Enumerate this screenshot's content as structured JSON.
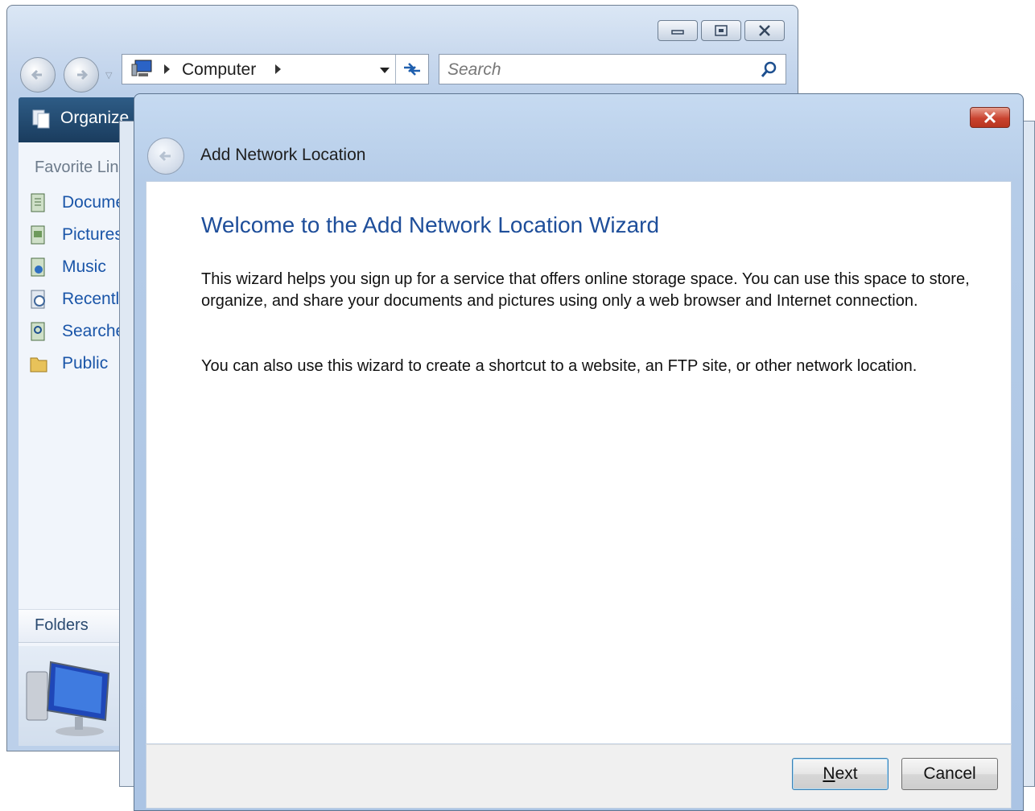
{
  "explorer": {
    "address": {
      "crumb": "Computer"
    },
    "search": {
      "placeholder": "Search"
    },
    "command_bar": {
      "organize_label": "Organize"
    },
    "favorite_links": {
      "title": "Favorite Links",
      "items": [
        {
          "label": "Documents",
          "icon": "documents-icon"
        },
        {
          "label": "Pictures",
          "icon": "pictures-icon"
        },
        {
          "label": "Music",
          "icon": "music-icon"
        },
        {
          "label": "Recently Changed",
          "icon": "recently-changed-icon"
        },
        {
          "label": "Searches",
          "icon": "searches-icon"
        },
        {
          "label": "Public",
          "icon": "public-folder-icon"
        }
      ]
    },
    "folders_label": "Folders"
  },
  "wizard": {
    "title": "Add Network Location",
    "heading": "Welcome to the Add Network Location Wizard",
    "paragraph1": "This wizard helps you sign up for a service that offers online storage space.  You can use this space to store, organize, and share your documents and pictures using only a web browser and Internet connection.",
    "paragraph2": "You can also use this wizard to create a shortcut to a website, an FTP site, or other network location.",
    "buttons": {
      "next_accel": "N",
      "next_rest": "ext",
      "cancel": "Cancel"
    }
  },
  "colors": {
    "heading_blue": "#1e4e9a",
    "link_blue": "#1a55a8",
    "close_red": "#c9432f",
    "command_bar": "#1a3c5e"
  }
}
